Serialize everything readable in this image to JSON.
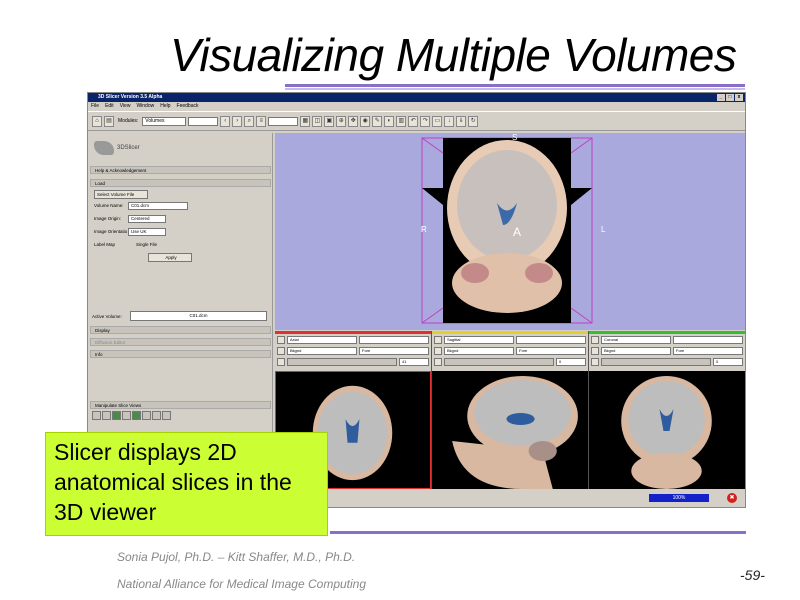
{
  "slide": {
    "title": "Visualizing Multiple Volumes",
    "callout": "Slicer displays 2D anatomical slices in the 3D viewer",
    "footer_authors": "Sonia Pujol, Ph.D. – Kitt Shaffer, M.D., Ph.D.",
    "footer_org": "National Alliance for Medical Image Computing",
    "page_number": "-59-"
  },
  "app": {
    "window_title": "3D Slicer Version 3.5 Alpha",
    "win_buttons": [
      "_",
      "□",
      "x"
    ],
    "menu": [
      "File",
      "Edit",
      "View",
      "Window",
      "Help",
      "Feedback"
    ],
    "toolbar": {
      "modules_label": "Modules:",
      "module_select": "Volumes"
    },
    "left_panel": {
      "logo_text": "3DSlicer",
      "help_section": "Help & Acknowledgement",
      "load_section": "Load",
      "select_volume_button": "Select Volume File",
      "volume_name_label": "Volume Name:",
      "volume_name_value": "C01.dcm",
      "image_origin_label": "Image Origin:",
      "image_origin_value": "Centered",
      "image_orientation_label": "Image Orientatio",
      "image_orientation_value": "Use UK",
      "label_map": "Label Map",
      "single_file": "Single File",
      "apply_button": "Apply",
      "active_volume_label": "Active Volume:",
      "active_volume_value": "C01.dcm",
      "display_section": "Display",
      "diffusion_section": "Diffusion Editor",
      "info_section": "Info",
      "manipulate_section": "Manipulate Slice Views"
    },
    "viewer3d": {
      "label_s": "S",
      "label_r": "R",
      "label_l": "L",
      "label_a": "A",
      "background": "#a9a9de"
    },
    "slices": [
      {
        "name": "Axial",
        "color": "#e03030",
        "orientation": "Axial",
        "bg": "Bkgnd",
        "layer": "Fore",
        "value": "41"
      },
      {
        "name": "Sagittal",
        "color": "#e0d030",
        "orientation": "Sagittal",
        "bg": "Bkgnd",
        "layer": "Fore",
        "value": "0"
      },
      {
        "name": "Coronal",
        "color": "#30c030",
        "orientation": "Coronal",
        "bg": "Bkgnd",
        "layer": "Fore",
        "value": "0"
      }
    ],
    "status": {
      "progress": "100%",
      "stop_symbol": "✖"
    }
  }
}
